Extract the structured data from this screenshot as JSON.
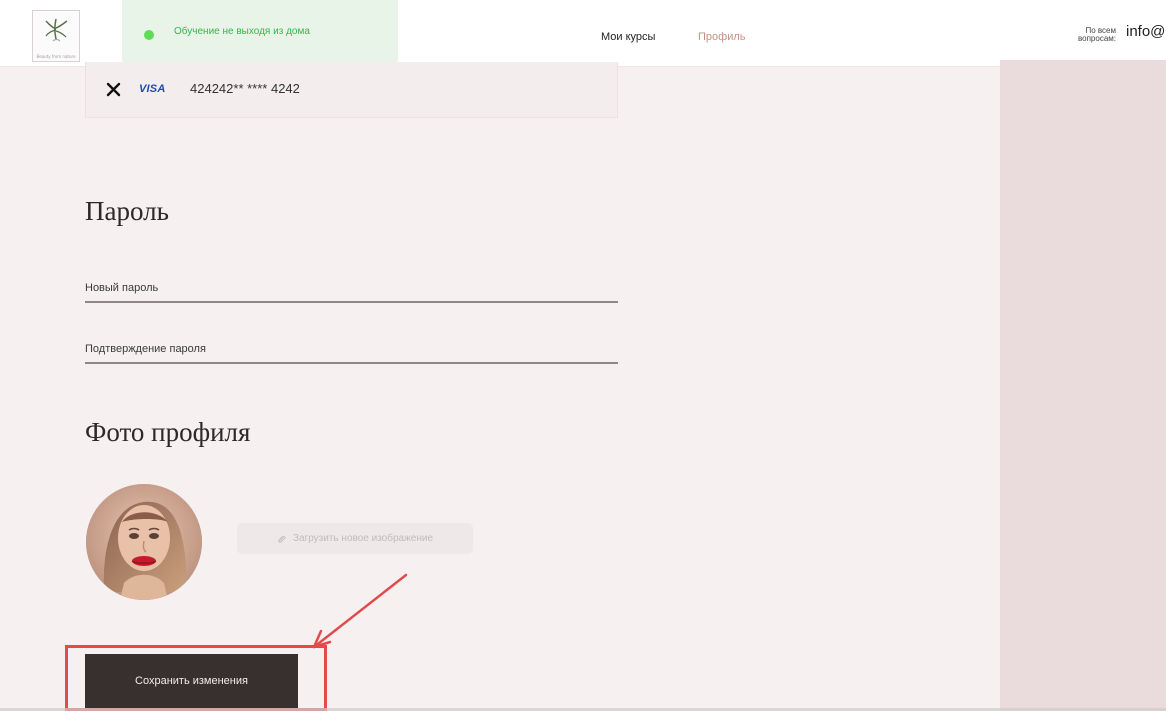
{
  "header": {
    "logo": {
      "icon": "plant-logo-icon",
      "caption": "Beauty from nature"
    },
    "promo": {
      "text": "Обучение не выходя из дома",
      "status_color": "#5fdc56"
    },
    "nav": {
      "courses_label": "Мои курсы",
      "profile_label": "Профиль",
      "active_color": "#c88f88"
    },
    "help_label_line1": "По всем",
    "help_label_line2": "вопросам:",
    "email_prefix": "info@"
  },
  "payment": {
    "brand": "VISA",
    "card_number": "424242** **** 4242"
  },
  "password": {
    "title": "Пароль",
    "new_placeholder": "Новый пароль",
    "confirm_placeholder": "Подтверждение пароля"
  },
  "photo": {
    "title": "Фото профиля",
    "upload_label": "Загрузить новое изображение"
  },
  "actions": {
    "save_label": "Сохранить изменения"
  },
  "colors": {
    "page_bg": "#f6f0f0",
    "right_pane": "#eadcdc",
    "save_button": "#382f2f",
    "annotation": "#e24b4b"
  },
  "icons": {
    "remove_card": "close-icon",
    "upload": "paperclip-icon"
  }
}
